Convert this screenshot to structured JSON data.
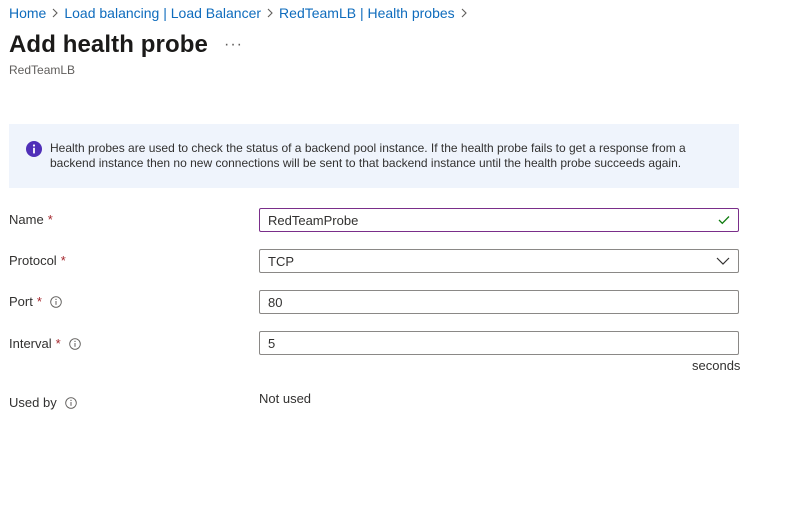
{
  "breadcrumb": {
    "items": [
      "Home",
      "Load balancing | Load Balancer",
      "RedTeamLB | Health probes"
    ]
  },
  "header": {
    "title": "Add health probe",
    "more": "···",
    "subtitle": "RedTeamLB"
  },
  "info": {
    "icon": "info-icon",
    "text": "Health probes are used to check the status of a backend pool instance. If the health probe fails to get a response from a backend instance then no new connections will be sent to that backend instance until the health probe succeeds again."
  },
  "form": {
    "required_marker": "*",
    "name": {
      "label": "Name",
      "value": "RedTeamProbe",
      "valid": true
    },
    "protocol": {
      "label": "Protocol",
      "value": "TCP"
    },
    "port": {
      "label": "Port",
      "value": "80"
    },
    "interval": {
      "label": "Interval",
      "value": "5",
      "unit": "seconds"
    },
    "used_by": {
      "label": "Used by",
      "value": "Not used"
    }
  },
  "colors": {
    "link": "#0f6cbd",
    "required": "#a4262c",
    "info_bg": "#eff4fc",
    "info_icon": "#4f2fb8",
    "focus_border": "#7a2e8a",
    "valid_check": "#107c10"
  }
}
